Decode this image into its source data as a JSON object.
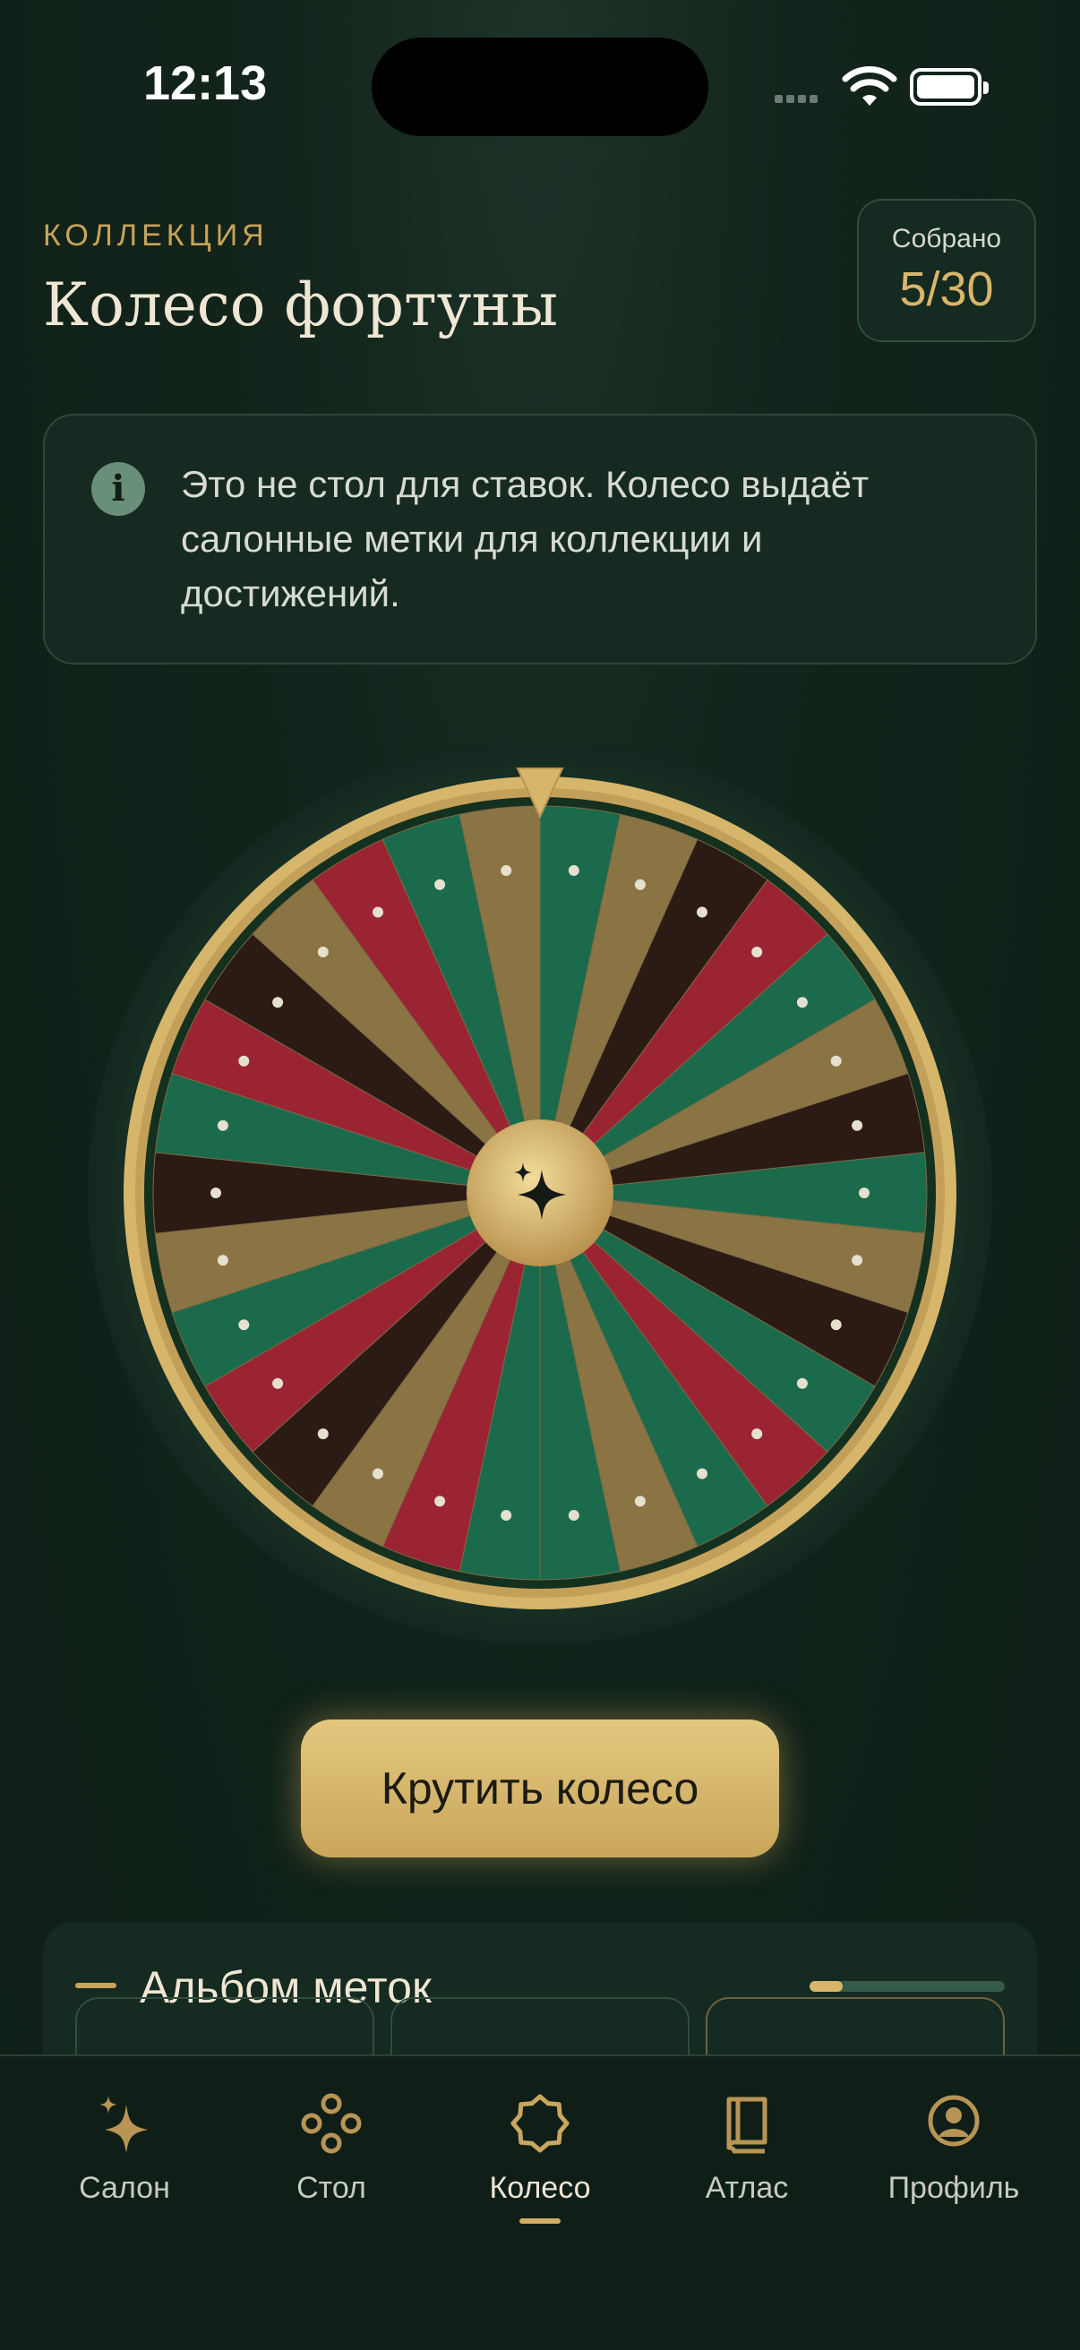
{
  "status_bar": {
    "time": "12:13"
  },
  "header": {
    "eyebrow": "КОЛЛЕКЦИЯ",
    "title": "Колесо фортуны",
    "counter_label": "Собрано",
    "counter_value": "5/30"
  },
  "notice": {
    "icon": "info-icon",
    "text": "Это не стол для ставок. Колесо выдаёт салонные метки для коллекции и достижений."
  },
  "wheel": {
    "segment_count": 30,
    "segment_colors": [
      "#1b6a4c",
      "#8b7444",
      "#2c1a14",
      "#9b2433",
      "#1b6a4c",
      "#8b7444",
      "#2c1a14",
      "#1b6a4c",
      "#8b7444",
      "#2c1a14",
      "#1b6a4c",
      "#9b2433",
      "#1b6a4c",
      "#8b7444",
      "#1b6a4c",
      "#1b6a4c",
      "#9b2433",
      "#8b7444",
      "#2c1a14",
      "#9b2433",
      "#1b6a4c",
      "#8b7444",
      "#2c1a14",
      "#1b6a4c",
      "#9b2433",
      "#2c1a14",
      "#8b7444",
      "#9b2433",
      "#1b6a4c",
      "#8b7444"
    ],
    "rim_color": "#d6b66a",
    "center_icon": "sparkle-icon"
  },
  "spin_button": {
    "label": "Крутить колесо"
  },
  "album": {
    "title": "Альбом меток",
    "progress_fraction": 0.17
  },
  "tabs": [
    {
      "label": "Салон",
      "icon": "sparkles-icon",
      "active": false
    },
    {
      "label": "Стол",
      "icon": "chips-icon",
      "active": false
    },
    {
      "label": "Колесо",
      "icon": "wheel-badge-icon",
      "active": true
    },
    {
      "label": "Атлас",
      "icon": "book-icon",
      "active": false
    },
    {
      "label": "Профиль",
      "icon": "profile-icon",
      "active": false
    }
  ],
  "colors": {
    "accent": "#d6b66a",
    "background": "#0f1f17"
  }
}
